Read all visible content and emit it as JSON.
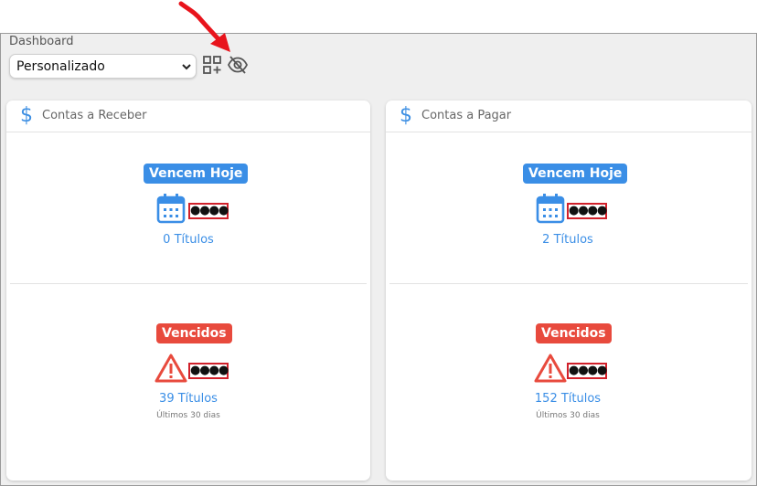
{
  "header": {
    "title": "Dashboard",
    "select_value": "Personalizado"
  },
  "icons": {
    "add_widget": "grid-plus-icon",
    "hide_values": "eye-slash-icon",
    "annotation": "red-arrow"
  },
  "colors": {
    "accent_blue": "#3a8ee6",
    "danger_red": "#e84a3d",
    "mask_border": "#d0202a"
  },
  "cards": [
    {
      "title": "Contas a Receber",
      "due_today": {
        "label": "Vencem Hoje",
        "masked": "●●●●",
        "count": "0 Títulos"
      },
      "overdue": {
        "label": "Vencidos",
        "masked": "●●●●",
        "count": "39 Títulos",
        "note": "Últimos 30 dias"
      }
    },
    {
      "title": "Contas a Pagar",
      "due_today": {
        "label": "Vencem Hoje",
        "masked": "●●●●",
        "count": "2 Títulos"
      },
      "overdue": {
        "label": "Vencidos",
        "masked": "●●●●",
        "count": "152 Títulos",
        "note": "Últimos 30 dias"
      }
    }
  ]
}
